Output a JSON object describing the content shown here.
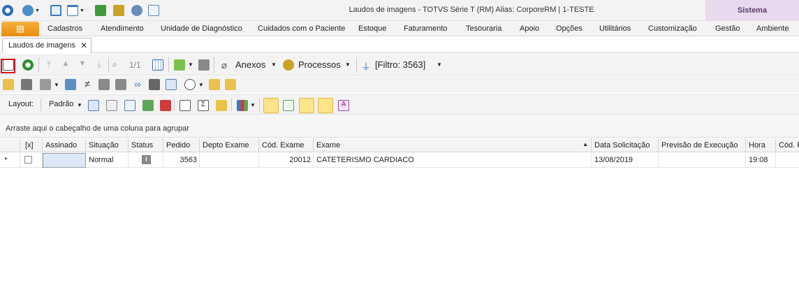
{
  "window": {
    "title": "Laudos de imagens - TOTVS Série T  (RM) Alias: CorporeRM | 1-TESTE",
    "context_tab": "Sistema"
  },
  "menu": {
    "items": [
      "Cadastros",
      "Atendimento",
      "Unidade de Diagnóstico",
      "Cuidados com o Paciente",
      "Estoque",
      "Faturamento",
      "Tesouraria",
      "Apoio",
      "Opções",
      "Utilitários",
      "Customização",
      "Gestão",
      "Ambiente"
    ]
  },
  "doc_tab": {
    "label": "Laudos de imagens",
    "close": "✕"
  },
  "toolbar": {
    "record_counter": "1/1",
    "anexos": "Anexos",
    "processos": "Processos",
    "filtro": "[Filtro: 3563]"
  },
  "layout_bar": {
    "layout_label": "Layout:",
    "layout_value": "Padrão"
  },
  "group_hint": "Arraste aqui o cabeçalho de uma coluna para agrupar",
  "grid": {
    "columns": [
      "[x]",
      "Assinado",
      "Situação",
      "Status",
      "Pedido",
      "Depto Exame",
      "Cód. Exame",
      "Exame",
      "Data Solicitação",
      "Previsão de Execução",
      "Hora",
      "Cód. P"
    ],
    "sort_indicator": "▲",
    "rows": [
      {
        "assinado": "",
        "situacao": "Normal",
        "status": "I",
        "pedido": "3563",
        "depto": "",
        "cod_exame": "20012",
        "exame": "CATETERISMO CARDIACO",
        "data": "13/08/2019",
        "previsao": "",
        "hora": "19:08",
        "cod_p": ""
      }
    ]
  },
  "colors": {
    "accent_orange": "#e88c0c",
    "context_purple": "#e8d9ee",
    "highlight_red": "#d2141b"
  }
}
